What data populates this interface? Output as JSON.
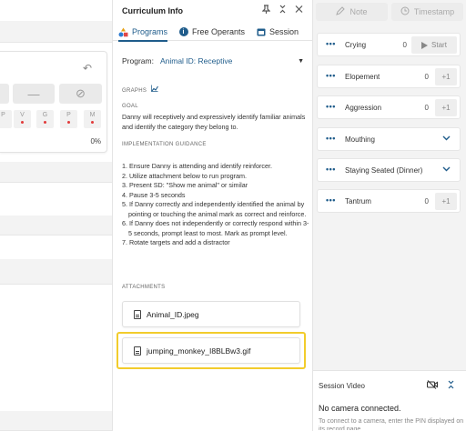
{
  "left_pane": {
    "undo_icon": "undo-icon",
    "minus_label": "—",
    "block_label": "⊘",
    "mini_letters": [
      "P",
      "V",
      "G",
      "P",
      "M"
    ],
    "percent": "0%"
  },
  "curriculum": {
    "title": "Curriculum Info",
    "header_icons": [
      "pin-icon",
      "collapse-icon",
      "close-icon"
    ],
    "tabs": [
      {
        "label": "Programs",
        "icon": "shapes-icon",
        "active": true
      },
      {
        "label": "Free Operants",
        "icon": "info-icon",
        "active": false
      },
      {
        "label": "Session",
        "icon": "calendar-icon",
        "active": false
      }
    ],
    "program_label": "Program:",
    "program_value": "Animal ID: Receptive",
    "graphs_label": "GRAPHS",
    "goal_label": "GOAL",
    "goal_text": "Danny will receptively and expressively identify familiar animals and identify the category they belong to.",
    "guidance_label": "IMPLEMENTATION GUIDANCE",
    "steps": [
      "1. Ensure Danny is attending and identify reinforcer.",
      "2. Utilize attachment below to run program.",
      "3. Present SD: \"Show me animal\" or similar",
      "4. Pause 3-5 seconds",
      "5. If Danny correctly and independently identified the animal by pointing or touching the animal mark as correct and reinforce.",
      "6. If Danny does not independently or correctly respond within 3-5 seconds, prompt least to most. Mark as prompt level.",
      "7. Rotate targets and add a distractor"
    ],
    "attachments_label": "ATTACHMENTS",
    "attachments": [
      "Animal_ID.jpeg",
      "jumping_monkey_I8BLBw3.gif"
    ]
  },
  "toolbar": {
    "note_label": "Note",
    "timestamp_label": "Timestamp"
  },
  "behaviors": [
    {
      "name": "Crying",
      "count": "0",
      "action": "Start"
    },
    {
      "name": "Elopement",
      "count": "0",
      "action": "+1"
    },
    {
      "name": "Aggression",
      "count": "0",
      "action": "+1"
    },
    {
      "name": "Mouthing",
      "count": "",
      "action": "expand"
    },
    {
      "name": "Staying Seated (Dinner)",
      "count": "",
      "action": "expand"
    },
    {
      "name": "Tantrum",
      "count": "0",
      "action": "+1"
    }
  ],
  "session_video": {
    "title": "Session Video",
    "status": "No camera connected.",
    "hint": "To connect to a camera, enter the PIN displayed on its record page."
  },
  "colors": {
    "accent": "#1f5c8b",
    "highlight": "#f2cc2c"
  }
}
